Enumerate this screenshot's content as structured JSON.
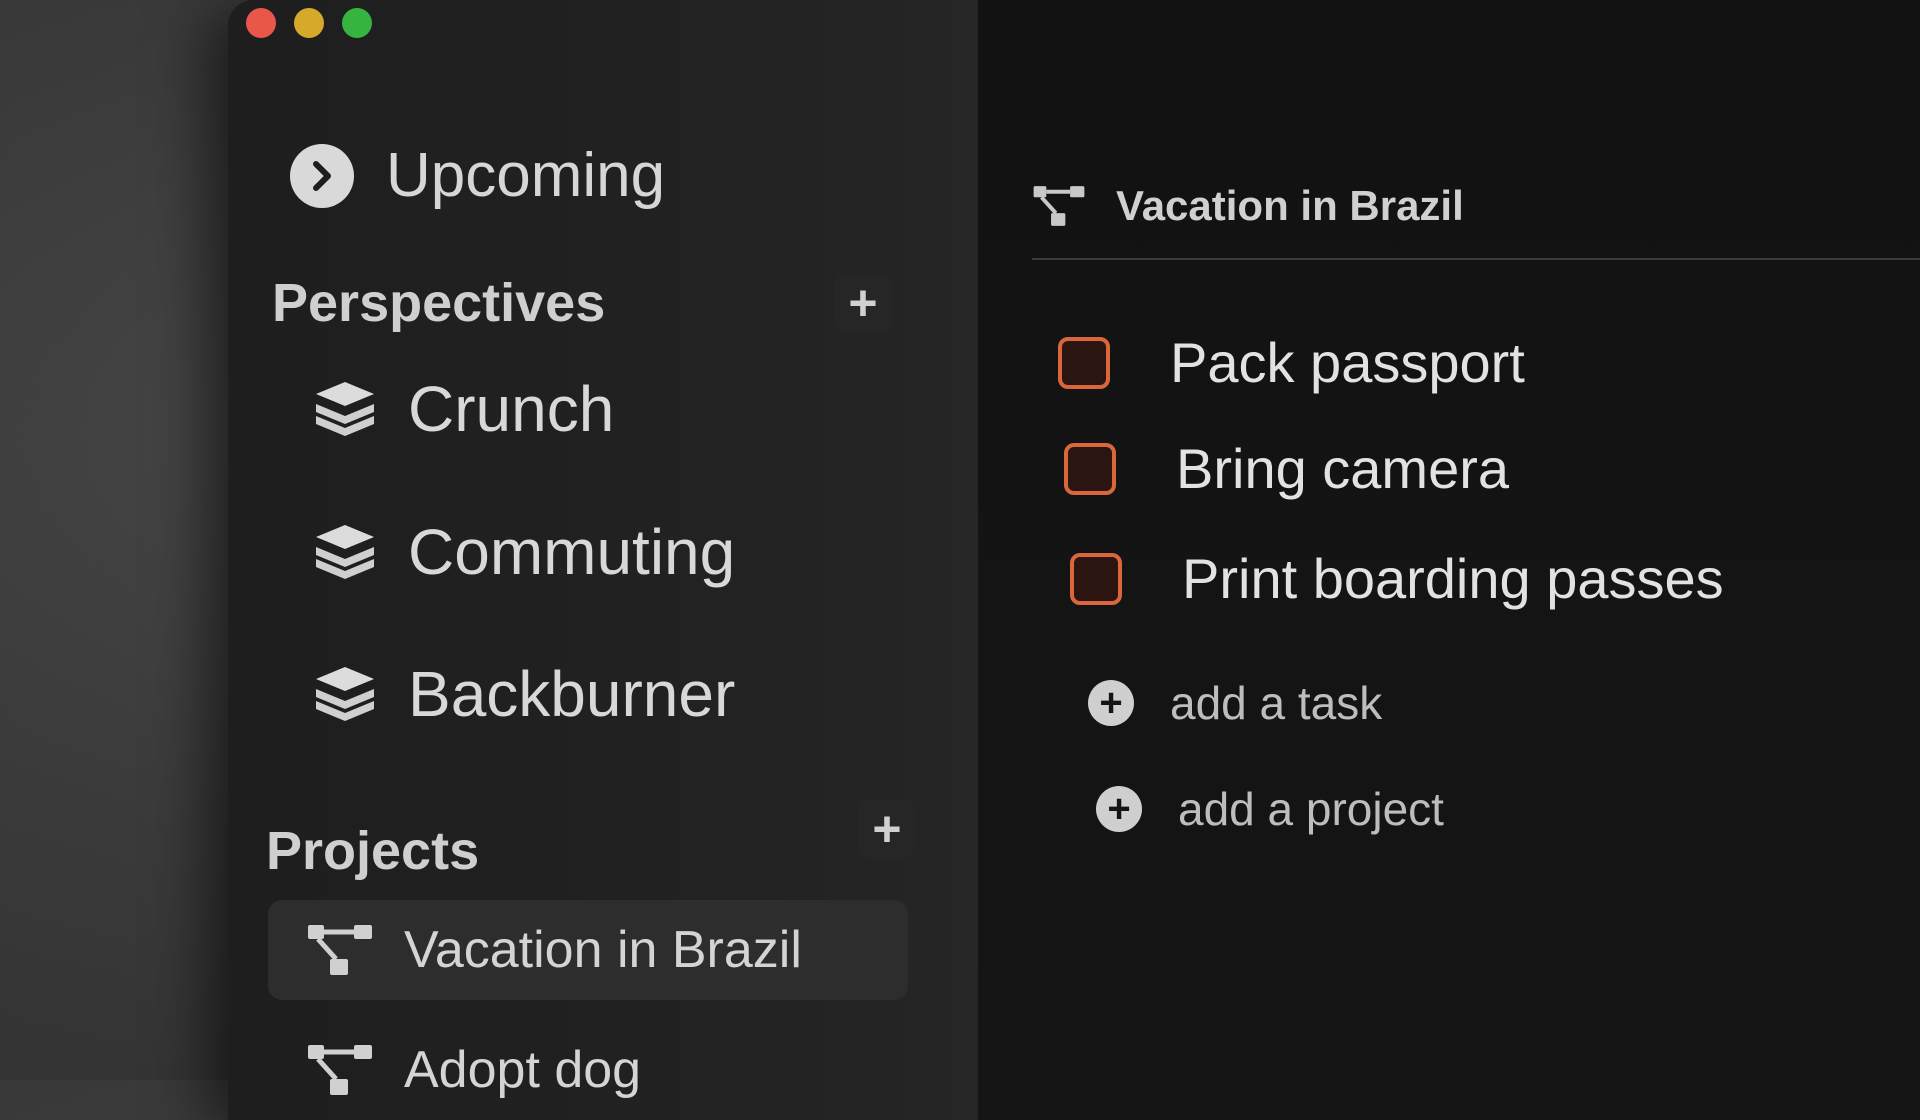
{
  "window": {
    "controls": [
      "close",
      "minimize",
      "zoom"
    ]
  },
  "sidebar": {
    "upcoming": {
      "label": "Upcoming",
      "icon": "chevron-right-circle-icon"
    },
    "perspectives": {
      "title": "Perspectives",
      "add_icon": "+",
      "items": [
        {
          "label": "Crunch",
          "icon": "layers-icon"
        },
        {
          "label": "Commuting",
          "icon": "layers-icon"
        },
        {
          "label": "Backburner",
          "icon": "layers-icon"
        }
      ]
    },
    "projects": {
      "title": "Projects",
      "add_icon": "+",
      "items": [
        {
          "label": "Vacation in Brazil",
          "icon": "project-tree-icon",
          "selected": true
        },
        {
          "label": "Adopt dog",
          "icon": "project-tree-icon",
          "selected": false
        }
      ]
    }
  },
  "main": {
    "title": "Vacation in Brazil",
    "title_icon": "project-tree-icon",
    "tasks": [
      {
        "label": "Pack passport",
        "checked": false
      },
      {
        "label": "Bring camera",
        "checked": false
      },
      {
        "label": "Print boarding passes",
        "checked": false
      }
    ],
    "add_task": {
      "label": "add a task",
      "icon": "+"
    },
    "add_project": {
      "label": "add a project",
      "icon": "+"
    }
  },
  "colors": {
    "accent_checkbox": "#d9673b",
    "close": "#e8574a",
    "minimize": "#d6a92a",
    "zoom": "#37b33f"
  }
}
